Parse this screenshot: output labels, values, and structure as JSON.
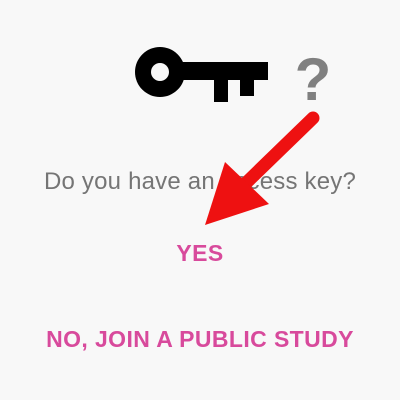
{
  "hero": {
    "key_icon": "key-icon",
    "question_icon": "question-mark-icon",
    "question_glyph": "?"
  },
  "prompt": {
    "text": "Do you have an access key?"
  },
  "actions": {
    "yes_label": "YES",
    "public_study_label": "NO, JOIN A PUBLIC STUDY"
  },
  "overlay": {
    "arrow_icon": "red-arrow-icon",
    "arrow_color": "#ee1111"
  },
  "colors": {
    "background": "#f8f8f8",
    "accent": "#d84a9c",
    "prompt_text": "#757575",
    "icon": "#000000",
    "question_mark": "#808080"
  }
}
